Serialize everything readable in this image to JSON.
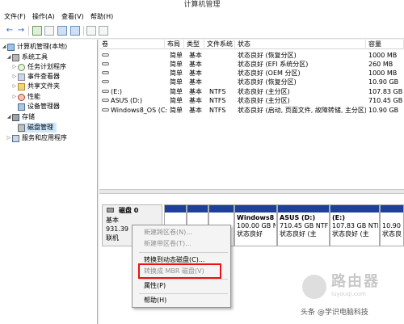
{
  "window": {
    "title": "计算机管理"
  },
  "menu": {
    "items": [
      "文件(F)",
      "操作(A)",
      "查看(V)",
      "帮助(H)"
    ]
  },
  "toolbar": {
    "buttons": [
      "back-arrow-icon",
      "forward-arrow-icon",
      "up-folder-icon",
      "show-tree-icon",
      "properties-icon",
      "help-icon",
      "refresh-icon",
      "export-icon"
    ]
  },
  "tree": {
    "items": [
      {
        "label": "计算机管理(本地)",
        "icon": "computer-icon"
      },
      {
        "label": "系统工具",
        "icon": "tools-icon"
      },
      {
        "label": "任务计划程序",
        "icon": "clock-icon"
      },
      {
        "label": "事件查看器",
        "icon": "event-log-icon"
      },
      {
        "label": "共享文件夹",
        "icon": "shared-folder-icon"
      },
      {
        "label": "性能",
        "icon": "performance-icon"
      },
      {
        "label": "设备管理器",
        "icon": "device-manager-icon"
      },
      {
        "label": "存储",
        "icon": "storage-icon"
      },
      {
        "label": "磁盘管理",
        "icon": "disk-icon"
      },
      {
        "label": "服务和应用程序",
        "icon": "services-icon"
      }
    ]
  },
  "volumes": {
    "columns": [
      "卷",
      "布局",
      "类型",
      "文件系统",
      "状态",
      "容量"
    ],
    "rows": [
      [
        "",
        "简单",
        "基本",
        "",
        "状态良好 (恢复分区)",
        "1000 MB"
      ],
      [
        "",
        "简单",
        "基本",
        "",
        "状态良好 (EFI 系统分区)",
        "260 MB"
      ],
      [
        "",
        "简单",
        "基本",
        "",
        "状态良好 (OEM 分区)",
        "1000 MB"
      ],
      [
        "",
        "简单",
        "基本",
        "",
        "状态良好 (恢复分区)",
        "10.90 GB"
      ],
      [
        "(E:)",
        "简单",
        "基本",
        "NTFS",
        "状态良好 (主分区)",
        "107.83 GB"
      ],
      [
        "ASUS (D:)",
        "简单",
        "基本",
        "NTFS",
        "状态良好 (主分区)",
        "710.45 GB"
      ],
      [
        "Windows8_OS (C:)",
        "简单",
        "基本",
        "NTFS",
        "状态良好 (启动, 页面文件, 故障转储, 主分区)",
        "10.90 GB"
      ]
    ]
  },
  "disk": {
    "name": "磁盘 0",
    "type": "基本",
    "size": "931.39",
    "status": "联机",
    "partitions": [
      {
        "name": "",
        "size": "",
        "status": ""
      },
      {
        "name": "",
        "size": "",
        "status": ""
      },
      {
        "name": "",
        "size": "",
        "status": ""
      },
      {
        "name": "Windows8",
        "size": "100.00 GB N",
        "status": "状态良好"
      },
      {
        "name": "ASUS (D:)",
        "size": "710.45 GB NTF",
        "status": "状态良好 (主"
      },
      {
        "name": "(E:)",
        "size": "107.83 GB NTF",
        "status": "状态良好 (主"
      },
      {
        "name": "",
        "size": "10.90 GB",
        "status": "状态良"
      }
    ]
  },
  "context_menu": {
    "items": [
      {
        "label": "新建跨区卷(N)...",
        "enabled": false
      },
      {
        "label": "新建带区卷(T)...",
        "enabled": false
      },
      {
        "label": "转换到动态磁盘(C)...",
        "enabled": true
      },
      {
        "label": "转换成 MBR 磁盘(V)",
        "enabled": false
      },
      {
        "label": "属性(P)",
        "enabled": true
      },
      {
        "label": "帮助(H)",
        "enabled": true
      }
    ]
  },
  "watermark": {
    "brand": "路由器",
    "url": "luyouqi.com"
  },
  "signature": "头条 @学识电脑科技",
  "colors": {
    "partition_bar": "#1f3f9c",
    "highlight_box": "#e11111",
    "selection": "#cde8ff"
  }
}
